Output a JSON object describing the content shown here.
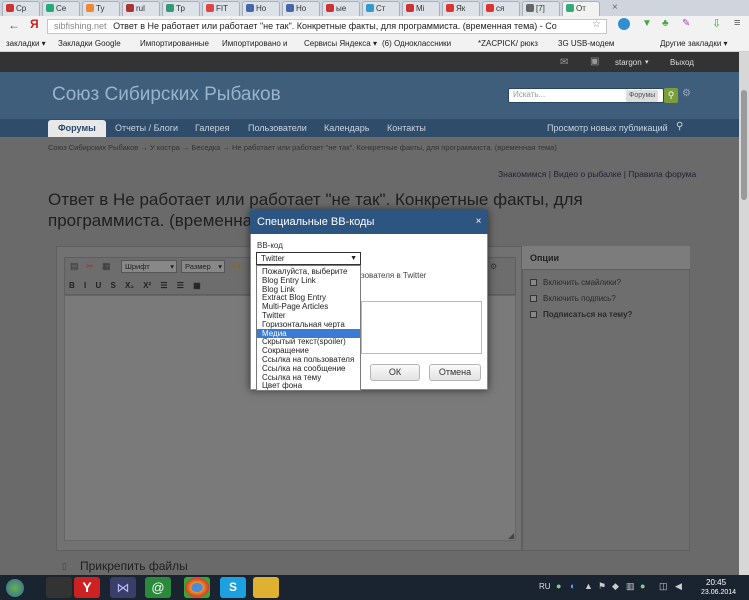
{
  "browser": {
    "tabs": [
      {
        "label": "Ср",
        "color": "#c33"
      },
      {
        "label": "Се",
        "color": "#2a7"
      },
      {
        "label": "Ту",
        "color": "#e83"
      },
      {
        "label": "rul",
        "color": "#a33"
      },
      {
        "label": "Тр",
        "color": "#397"
      },
      {
        "label": "FIT",
        "color": "#d44"
      },
      {
        "label": "Но",
        "color": "#46a"
      },
      {
        "label": "Но",
        "color": "#46a"
      },
      {
        "label": "ые",
        "color": "#c33"
      },
      {
        "label": "Ст",
        "color": "#39c"
      },
      {
        "label": "Мі",
        "color": "#c33"
      },
      {
        "label": "Як",
        "color": "#d33"
      },
      {
        "label": "ся",
        "color": "#d33"
      },
      {
        "label": "[7]",
        "color": "#666"
      },
      {
        "label": "От",
        "color": "#3a7"
      }
    ],
    "url_domain": "sibfishing.net",
    "url_title": "Ответ в Не работает или работает \"не так\". Конкретные факты, для программиста. (временная тема) - Со",
    "bookmarks": [
      "закладки ▾",
      "Закладки Google",
      "Импортированные",
      "Импортировано и",
      "Сервисы Яндекса ▾",
      "(6) Одноклассники",
      "*ZACPICK/ рюкз",
      "3G USB-модем",
      "Другие закладки ▾"
    ]
  },
  "site": {
    "user": "stargon",
    "logout": "Выход",
    "title": "Союз Сибирских Рыбаков",
    "search_placeholder": "Искать...",
    "search_scope": "Форумы",
    "nav": [
      "Форумы",
      "Отчеты / Блоги",
      "Галерея",
      "Пользователи",
      "Календарь",
      "Контакты"
    ],
    "nav_right": "Просмотр новых публикаций",
    "breadcrumb": "Союз Сибирских Рыбаков   →   У костра   →   Беседка   →   Не работает или работает \"не так\". Конкретные факты, для программиста. (временная тема)",
    "links": "Знакомимся | Видео о рыбалке | Правила форума",
    "page_title_line1": "Ответ в Не работает или работает \"не так\". Конкретные факты, для",
    "page_title_line2": "программиста. (временна",
    "editor_font": "Шрифт",
    "editor_size": "Размер",
    "options_title": "Опции",
    "options": [
      "Включить смайлики?",
      "Включить подпись?",
      "Подписаться на тему?"
    ],
    "attach": "Прикрепить файлы"
  },
  "modal": {
    "title": "Специальные BB-коды",
    "close": "×",
    "field_label": "BB-код",
    "select_value": "Twitter",
    "hint": "зователя в Twitter",
    "ok": "ОК",
    "cancel": "Отмена",
    "options": [
      "Пожалуйста, выберите",
      "Blog Entry Link",
      "Blog Link",
      "Extract Blog Entry",
      "Multi-Page Articles",
      "Twitter",
      "Горизонтальная черта",
      "Медиа",
      "Скрытый текст(spoiler)",
      "Сокращение",
      "Ссылка на пользователя",
      "Ссылка на сообщение",
      "Ссылка на тему",
      "Цвет фона"
    ],
    "highlighted_index": 7
  },
  "taskbar": {
    "lang": "RU",
    "time": "20:45",
    "date": "23.06.2014"
  }
}
